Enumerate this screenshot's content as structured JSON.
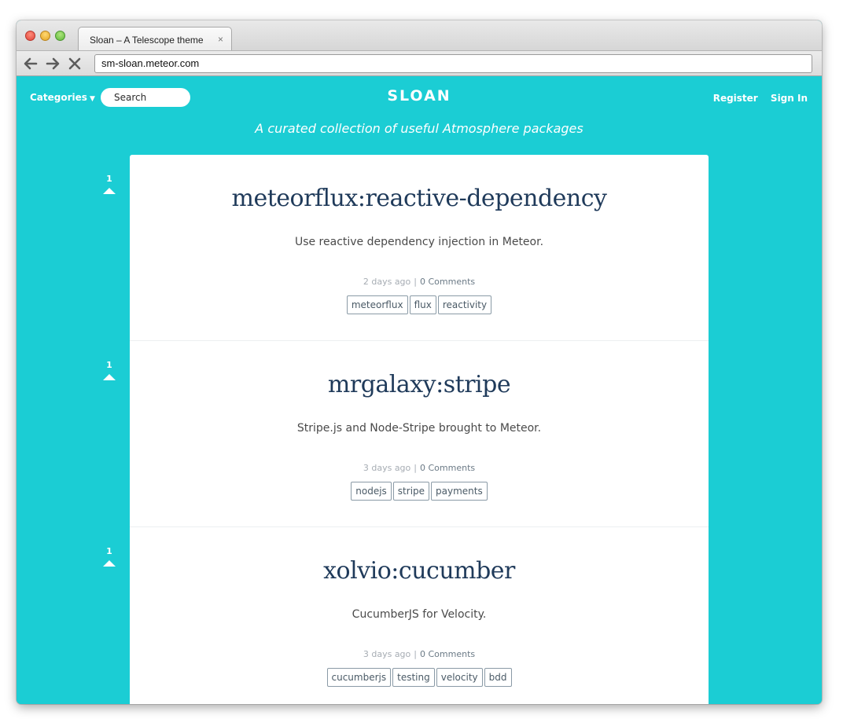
{
  "browser": {
    "tab_title": "Sloan – A Telescope theme",
    "tab_close": "×",
    "url": "sm-sloan.meteor.com"
  },
  "header": {
    "categories_label": "Categories",
    "categories_caret": "▼",
    "search_placeholder": "Search",
    "logo": "SLOAN",
    "register_label": "Register",
    "signin_label": "Sign In",
    "tagline": "A curated collection of useful Atmosphere packages"
  },
  "posts": [
    {
      "title": "meteorflux:reactive-dependency",
      "description": "Use reactive dependency injection in Meteor.",
      "age": "2 days ago",
      "separator": "|",
      "comments": "0 Comments",
      "votes": "1",
      "tags": [
        "meteorflux",
        "flux",
        "reactivity"
      ]
    },
    {
      "title": "mrgalaxy:stripe",
      "description": "Stripe.js and Node-Stripe brought to Meteor.",
      "age": "3 days ago",
      "separator": "|",
      "comments": "0 Comments",
      "votes": "1",
      "tags": [
        "nodejs",
        "stripe",
        "payments"
      ]
    },
    {
      "title": "xolvio:cucumber",
      "description": "CucumberJS for Velocity.",
      "age": "3 days ago",
      "separator": "|",
      "comments": "0 Comments",
      "votes": "1",
      "tags": [
        "cucumberjs",
        "testing",
        "velocity",
        "bdd"
      ]
    }
  ],
  "colors": {
    "brand_teal": "#1bcdd4",
    "title_navy": "#1f3a5a"
  }
}
